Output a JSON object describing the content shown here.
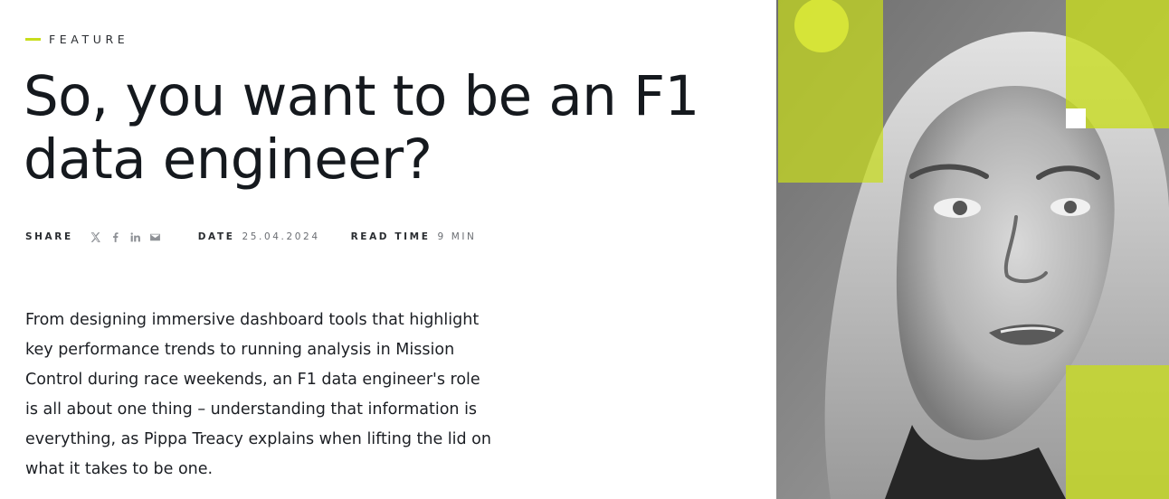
{
  "article": {
    "category": "FEATURE",
    "title": "So, you want to be an F1 data engineer?",
    "share_label": "SHARE",
    "share_icons": [
      "x-icon",
      "facebook-icon",
      "linkedin-icon",
      "email-icon"
    ],
    "date_label": "DATE",
    "date_value": "25.04.2024",
    "read_time_label": "READ TIME",
    "read_time_value": "9 MIN",
    "lead": "From designing immersive dashboard tools that highlight key performance trends to running analysis in Mission Control during race weekends, an F1 data engineer's role is all about one thing – understanding that information is everything, as Pippa Treacy explains when lifting the lid on what it takes to be one."
  },
  "colors": {
    "accent": "#c8dd1c",
    "text": "#15191e",
    "muted": "#6b6e73",
    "icon": "#8e9196"
  }
}
